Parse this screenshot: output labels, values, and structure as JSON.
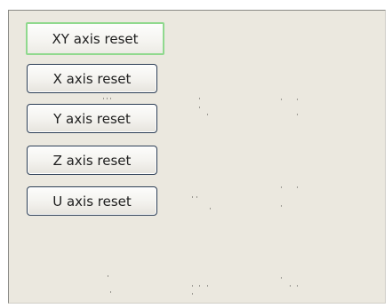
{
  "axis_reset_panel": {
    "buttons": [
      {
        "label": "XY axis reset",
        "focused": true
      },
      {
        "label": "X axis reset",
        "focused": false
      },
      {
        "label": "Y axis reset",
        "focused": false
      },
      {
        "label": "Z axis reset",
        "focused": false
      },
      {
        "label": "U axis reset",
        "focused": false
      }
    ]
  },
  "colors": {
    "panel_background": "#ebe8df",
    "button_border": "#2b3d55",
    "focus_outline": "#90d98e"
  }
}
